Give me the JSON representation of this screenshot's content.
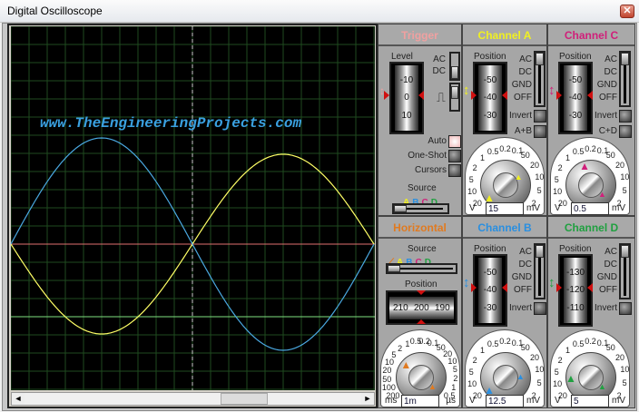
{
  "window": {
    "title": "Digital Oscilloscope",
    "close_icon": "close-x"
  },
  "screen": {
    "watermark": "www.TheEngineeringProjects.com",
    "trace_colors": {
      "A": "#ffff66",
      "B": "#4aa8e0",
      "trigger": "#ff7070",
      "ground_marker": "#80ff80"
    }
  },
  "scrollbar": {
    "left": "◄",
    "right": "►"
  },
  "colors": {
    "A": "#f0f020",
    "B": "#2a8fe0",
    "C": "#d0207a",
    "D": "#20a040",
    "trigger": "#f0a0a0",
    "horizontal": "#e07a20",
    "marker": "#d01010"
  },
  "trigger": {
    "title": "Trigger",
    "level_label": "Level",
    "scale": [
      "-10",
      "0",
      "10"
    ],
    "ac": "AC",
    "dc": "DC",
    "auto": "Auto",
    "oneshot": "One-Shot",
    "cursors": "Cursors",
    "source_label": "Source",
    "sources": [
      "A",
      "B",
      "C",
      "D"
    ],
    "edge_rising": "⌠",
    "edge_falling": "⌡"
  },
  "horizontal": {
    "title": "Horizontal",
    "source_label": "Source",
    "sources": [
      "A",
      "B",
      "C",
      "D"
    ],
    "ramp": "⟋",
    "position_label": "Position",
    "scale": [
      "210",
      "200",
      "190"
    ],
    "dial_left": [
      "200",
      "100",
      "50",
      "20",
      "10",
      "5",
      "2",
      "1",
      "0.5",
      "0.2",
      "0.1"
    ],
    "dial_right": [
      "50",
      "20",
      "10",
      "5",
      "2",
      "1",
      "0.5"
    ],
    "unit_left": "ms",
    "unit_right": "µs",
    "value": "1m"
  },
  "channels": {
    "A": {
      "title": "Channel A",
      "position_label": "Position",
      "scale": [
        "-50",
        "-40",
        "-30"
      ],
      "modes": [
        "AC",
        "DC",
        "GND",
        "OFF"
      ],
      "invert": "Invert",
      "combine": "A+B",
      "value": "15"
    },
    "C": {
      "title": "Channel C",
      "position_label": "Position",
      "scale": [
        "-50",
        "-40",
        "-30"
      ],
      "modes": [
        "AC",
        "DC",
        "GND",
        "OFF"
      ],
      "invert": "Invert",
      "combine": "C+D",
      "value": "0.5"
    },
    "B": {
      "title": "Channel B",
      "position_label": "Position",
      "scale": [
        "-50",
        "-40",
        "-30"
      ],
      "modes": [
        "AC",
        "DC",
        "GND",
        "OFF"
      ],
      "invert": "Invert",
      "combine": "",
      "value": "12.5"
    },
    "D": {
      "title": "Channel D",
      "position_label": "Position",
      "scale": [
        "-130",
        "-120",
        "-110"
      ],
      "modes": [
        "AC",
        "DC",
        "GND",
        "OFF"
      ],
      "invert": "Invert",
      "combine": "",
      "value": "5"
    }
  },
  "dial": {
    "left": [
      "20",
      "10",
      "5",
      "2",
      "1",
      "0.5",
      "0.2",
      "0.1"
    ],
    "right": [
      "50",
      "20",
      "10",
      "5",
      "2"
    ],
    "unit_left": "V",
    "unit_right": "mV"
  }
}
